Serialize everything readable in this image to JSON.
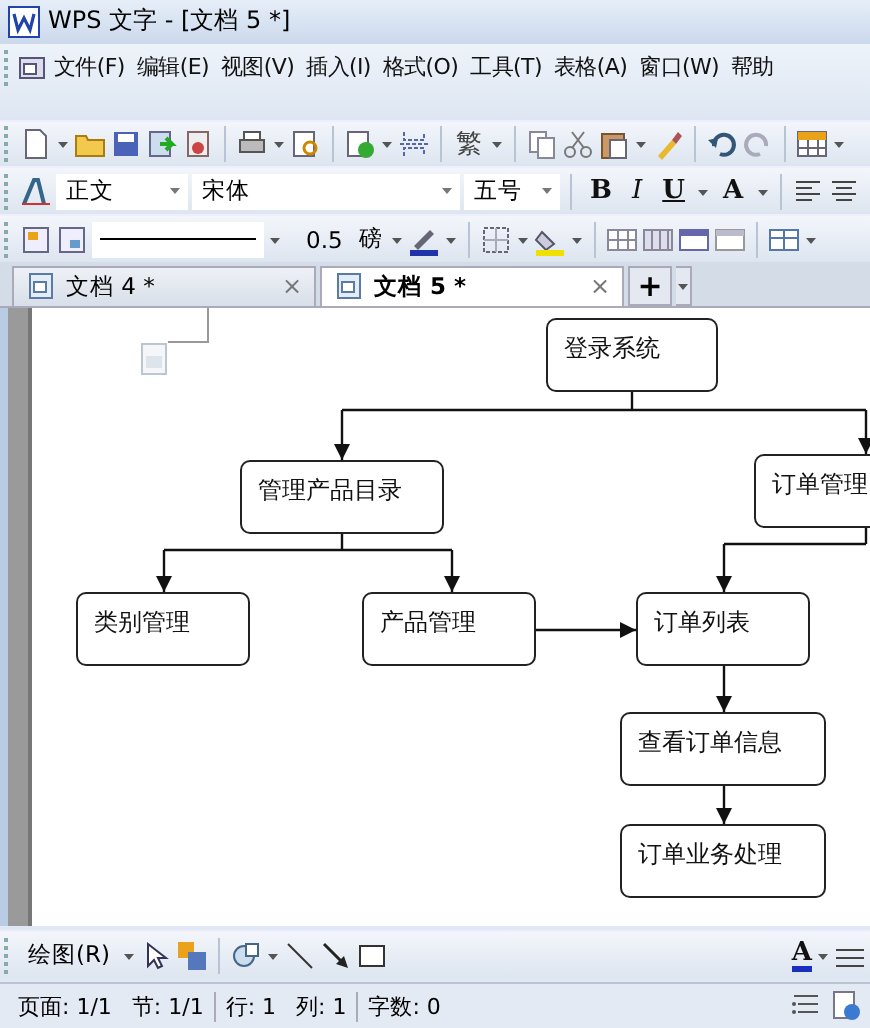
{
  "window": {
    "title": "WPS 文字 - [文档 5 *]"
  },
  "menu": [
    "文件(F)",
    "编辑(E)",
    "视图(V)",
    "插入(I)",
    "格式(O)",
    "工具(T)",
    "表格(A)",
    "窗口(W)",
    "帮助"
  ],
  "standard_toolbar": {
    "traditional_button": "繁"
  },
  "format_toolbar": {
    "style": "正文",
    "font": "宋体",
    "size": "五号",
    "buttons": [
      {
        "label": "B",
        "kind": "bold"
      },
      {
        "label": "I",
        "kind": "italic"
      },
      {
        "label": "U",
        "kind": "underline"
      },
      {
        "label": "A",
        "kind": "grow"
      }
    ]
  },
  "line_toolbar": {
    "line_weight": "0.5",
    "unit": "磅"
  },
  "tabs": [
    {
      "label": "文档 4 *",
      "close": "×",
      "selected": false
    },
    {
      "label": "文档 5 *",
      "close": "×",
      "selected": true
    }
  ],
  "new_tab": "+",
  "flowchart": {
    "nodes": [
      {
        "label": "登录系统"
      },
      {
        "label": "管理产品目录"
      },
      {
        "label": "订单管理"
      },
      {
        "label": "类别管理"
      },
      {
        "label": "产品管理"
      },
      {
        "label": "订单列表"
      },
      {
        "label": "查看订单信息"
      },
      {
        "label": "订单业务处理"
      }
    ]
  },
  "drawing_toolbar": {
    "label": "绘图(R)",
    "font_color": "A"
  },
  "status_bar": [
    "页面: 1/1",
    "节: 1/1",
    "行: 1",
    "列: 1",
    "字数: 0"
  ]
}
